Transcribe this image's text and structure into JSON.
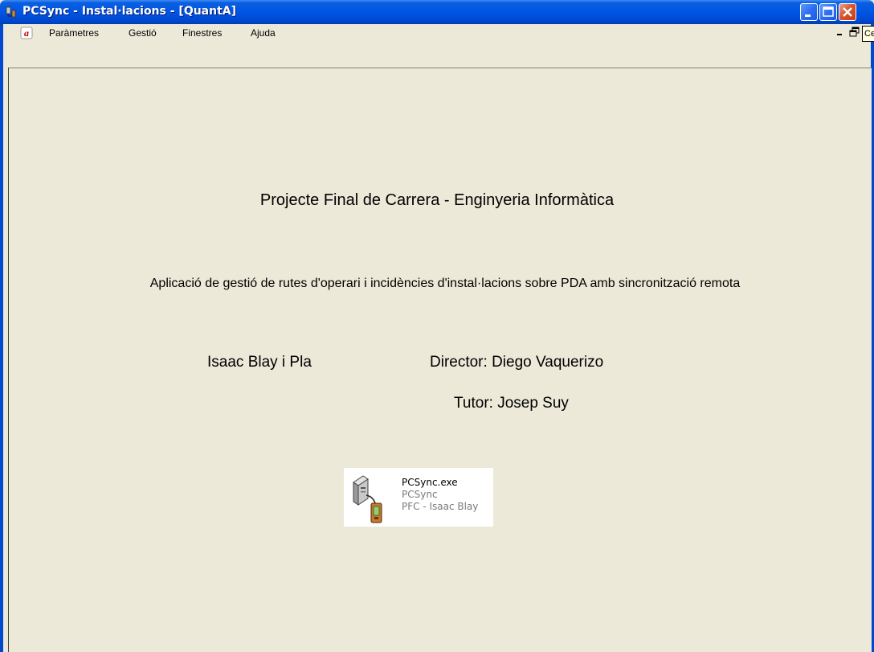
{
  "window": {
    "title": "PCSync - Instal·lacions - [QuantA]"
  },
  "menu": {
    "items": [
      {
        "label": "Paràmetres"
      },
      {
        "label": "Gestió"
      },
      {
        "label": "Finestres"
      },
      {
        "label": "Ajuda"
      }
    ]
  },
  "tooltip": {
    "text": "Ce"
  },
  "about": {
    "heading": "Projecte Final de Carrera - Enginyeria Informàtica",
    "subtitle": "Aplicació de gestió de rutes d'operari i incidències d'instal·lacions sobre PDA amb sincronització remota",
    "author": "Isaac Blay i Pla",
    "director": "Director: Diego Vaquerizo",
    "tutor": "Tutor: Josep Suy"
  },
  "file": {
    "name": "PCSync.exe",
    "description": "PCSync",
    "company": "PFC - Isaac Blay"
  },
  "icons": {
    "app": "app-sync-icon",
    "document": "mdi-document-icon",
    "file": "pda-computer-sync-icon"
  },
  "colors": {
    "titlebar": "#0055e5",
    "background": "#ece9d8",
    "close_button": "#d9562f"
  }
}
